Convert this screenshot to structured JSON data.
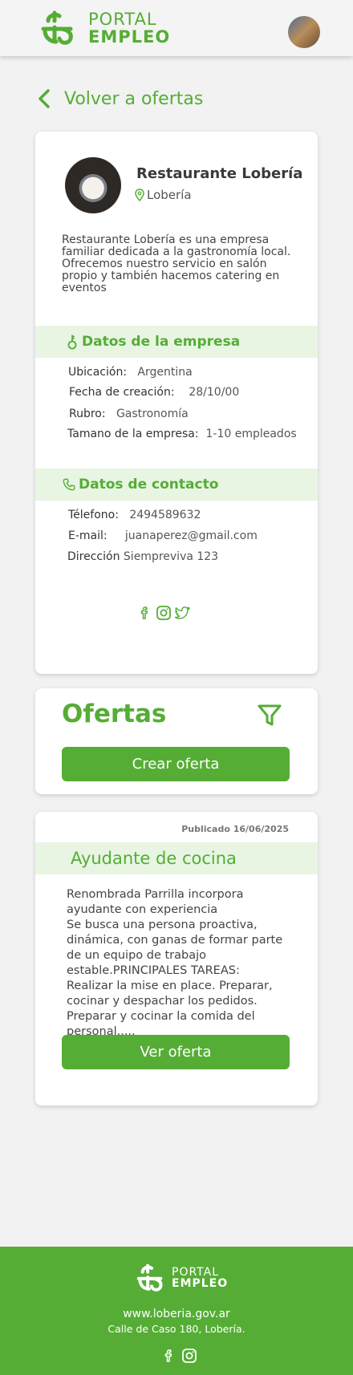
{
  "header": {
    "logo_line1": "PORTAL",
    "logo_line2": "EMPLEO"
  },
  "back_link": {
    "label": "Volver a ofertas"
  },
  "company": {
    "name": "Restaurante Lobería",
    "location": "Lobería",
    "description": "Restaurante Lobería es una empresa familiar dedicada a la gastronomía local. Ofrecemos nuestro servicio en salón propio  y también hacemos catering en eventos"
  },
  "company_data": {
    "section_title": "Datos de la empresa",
    "ubicacion_label": "Ubicación:",
    "ubicacion_value": "Argentina",
    "fecha_label": "Fecha de creación:",
    "fecha_value": "28/10/00",
    "rubro_label": "Rubro:",
    "rubro_value": "Gastronomía",
    "tamano_label": "Tamano de la empresa:",
    "tamano_value": "1-10 empleados"
  },
  "contact": {
    "section_title": "Datos de contacto",
    "phone_label": "Télefono:",
    "phone_value": "2494589632",
    "email_label": "E-mail:",
    "email_value": "juanaperez@gmail.com",
    "address_label": "Dirección",
    "address_value": "Siempreviva 123"
  },
  "ofertas": {
    "title": "Ofertas",
    "create_button": "Crear oferta"
  },
  "offer": {
    "published": "Publicado 16/06/2025",
    "title": "Ayudante de cocina",
    "description": "Renombrada Parrilla incorpora ayudante con experiencia\nSe busca una persona proactiva, dinámica, con ganas de formar parte de un equipo de trabajo estable.PRINCIPALES TAREAS: Realizar la mise en place. Preparar, cocinar y despachar los pedidos. Preparar y cocinar la comida del personal.....",
    "button": "Ver oferta"
  },
  "footer": {
    "logo_line1": "PORTAL",
    "logo_line2": "EMPLEO",
    "website": "www.loberia.gov.ar",
    "address": "Calle de Caso 180, Lobería."
  },
  "colors": {
    "brand_green": "#55ad35",
    "band_green": "#e8f5e3"
  }
}
